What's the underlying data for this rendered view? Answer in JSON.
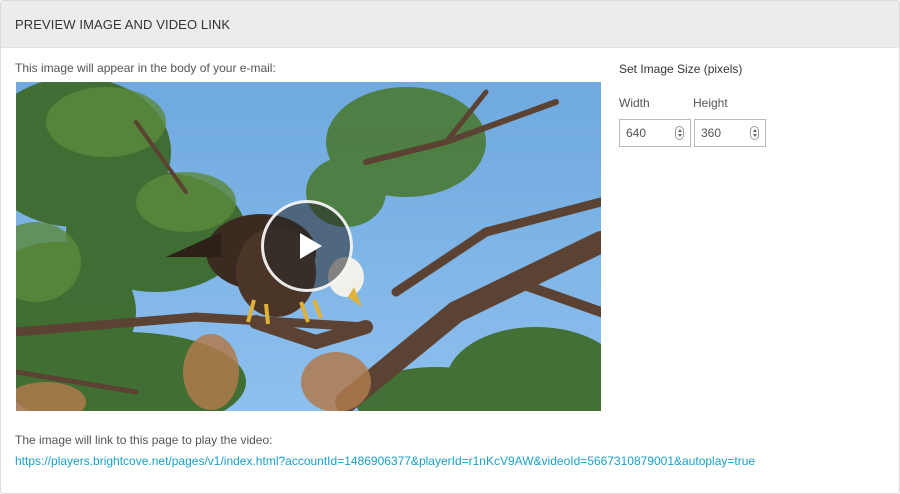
{
  "header": {
    "title": "PREVIEW IMAGE AND VIDEO LINK"
  },
  "preview": {
    "caption": "This image will appear in the body of your e-mail:",
    "image_subject": "bald eagle perched on pine branches",
    "play_icon": "play-icon"
  },
  "size": {
    "title": "Set Image Size (pixels)",
    "width_label": "Width",
    "width_value": "640",
    "height_label": "Height",
    "height_value": "360"
  },
  "link": {
    "caption": "The image will link to this page to play the video:",
    "url": "https://players.brightcove.net/pages/v1/index.html?accountId=1486906377&playerId=r1nKcV9AW&videoId=5667310879001&autoplay=true"
  },
  "colors": {
    "header_bg": "#ececec",
    "link": "#1aa0c8",
    "sky": "#7cb4e6"
  }
}
